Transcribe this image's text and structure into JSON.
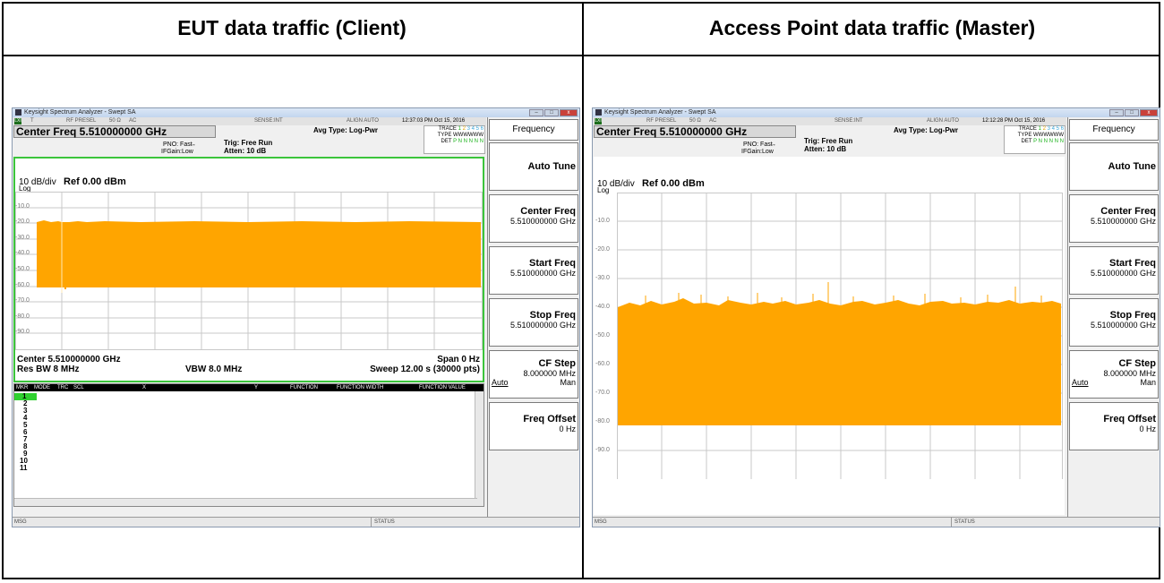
{
  "columns": {
    "left": "EUT data traffic (Client)",
    "right": "Access Point data traffic (Master)"
  },
  "common": {
    "window_title": "Keysight Spectrum Analyzer - Swept SA",
    "lxi": "LXI",
    "trig_label": "T",
    "rf": "RF PRESEL",
    "ohm": "50 Ω",
    "ac": "AC",
    "sense": "SENSE:INT",
    "align": "ALIGN AUTO",
    "center_freq": "Center Freq 5.510000000 GHz",
    "pno": "PNO: Fast",
    "ifgain": "IFGain:Low",
    "trig": "Trig: Free Run",
    "atten": "Atten: 10 dB",
    "avg_type": "Avg Type: Log-Pwr",
    "trace_label": "TRACE",
    "trace_nums": "1 2 3 4 5 6",
    "type_label": "TYPE",
    "type_val": "WWWWWW",
    "det_label": "DET",
    "det_val": "P N N N N N",
    "scale": "10 dB/div",
    "ref": "Ref 0.00 dBm",
    "log": "Log",
    "center_foot": "Center 5.510000000 GHz",
    "res_bw": "Res BW 8 MHz",
    "vbw": "VBW 8.0 MHz",
    "span": "Span 0 Hz",
    "sweep": "Sweep  12.00 s (30000 pts)",
    "msg": "MSG",
    "status": "STATUS",
    "softkeys": {
      "menu": "Frequency",
      "auto_tune": "Auto Tune",
      "center_freq": "Center Freq",
      "center_val": "5.510000000 GHz",
      "start_freq": "Start Freq",
      "start_val": "5.510000000 GHz",
      "stop_freq": "Stop Freq",
      "stop_val": "5.510000000 GHz",
      "cf_step": "CF Step",
      "cf_step_val": "8.000000 MHz",
      "auto": "Auto",
      "man": "Man",
      "freq_offset": "Freq Offset",
      "freq_offset_val": "0 Hz"
    }
  },
  "left": {
    "time": "12:37:03 PM Oct 15, 2016",
    "y_labels": [
      "-10.0",
      "-20.0",
      "-30.0",
      "-40.0",
      "-50.0",
      "-60.0",
      "-70.0",
      "-80.0",
      "-90.0"
    ],
    "marker_table": {
      "headers": [
        "MKR",
        "MODE",
        "TRC",
        "SCL",
        "X",
        "Y",
        "FUNCTION",
        "FUNCTION WIDTH",
        "FUNCTION VALUE"
      ],
      "rows": [
        "1",
        "2",
        "3",
        "4",
        "5",
        "6",
        "7",
        "8",
        "9",
        "10",
        "11"
      ]
    }
  },
  "right": {
    "time": "12:12:28 PM Oct 15, 2016",
    "y_labels": [
      "-10.0",
      "-20.0",
      "-30.0",
      "-40.0",
      "-50.0",
      "-60.0",
      "-70.0",
      "-80.0",
      "-90.0"
    ]
  },
  "colors": {
    "trace": "#ffa500",
    "plot_border": "#3bc43b",
    "marker_select": "#2fd12f"
  }
}
